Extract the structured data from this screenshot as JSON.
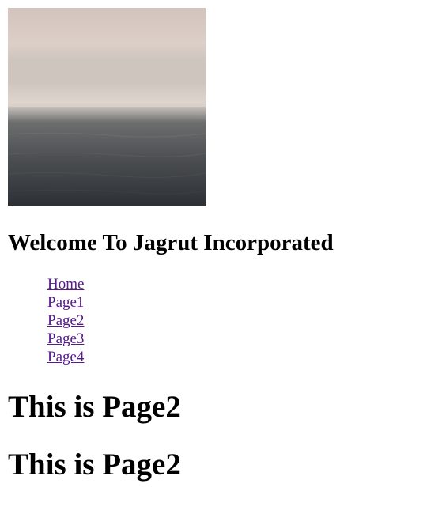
{
  "header": {
    "title": "Welcome To Jagrut Incorporated"
  },
  "nav": {
    "items": [
      {
        "label": "Home"
      },
      {
        "label": "Page1"
      },
      {
        "label": "Page2"
      },
      {
        "label": "Page3"
      },
      {
        "label": "Page4"
      }
    ],
    "link_color": "#551a8b"
  },
  "main": {
    "headings": [
      "This is Page2",
      "This is Page2"
    ]
  },
  "image": {
    "subject": "misty sea horizon"
  }
}
